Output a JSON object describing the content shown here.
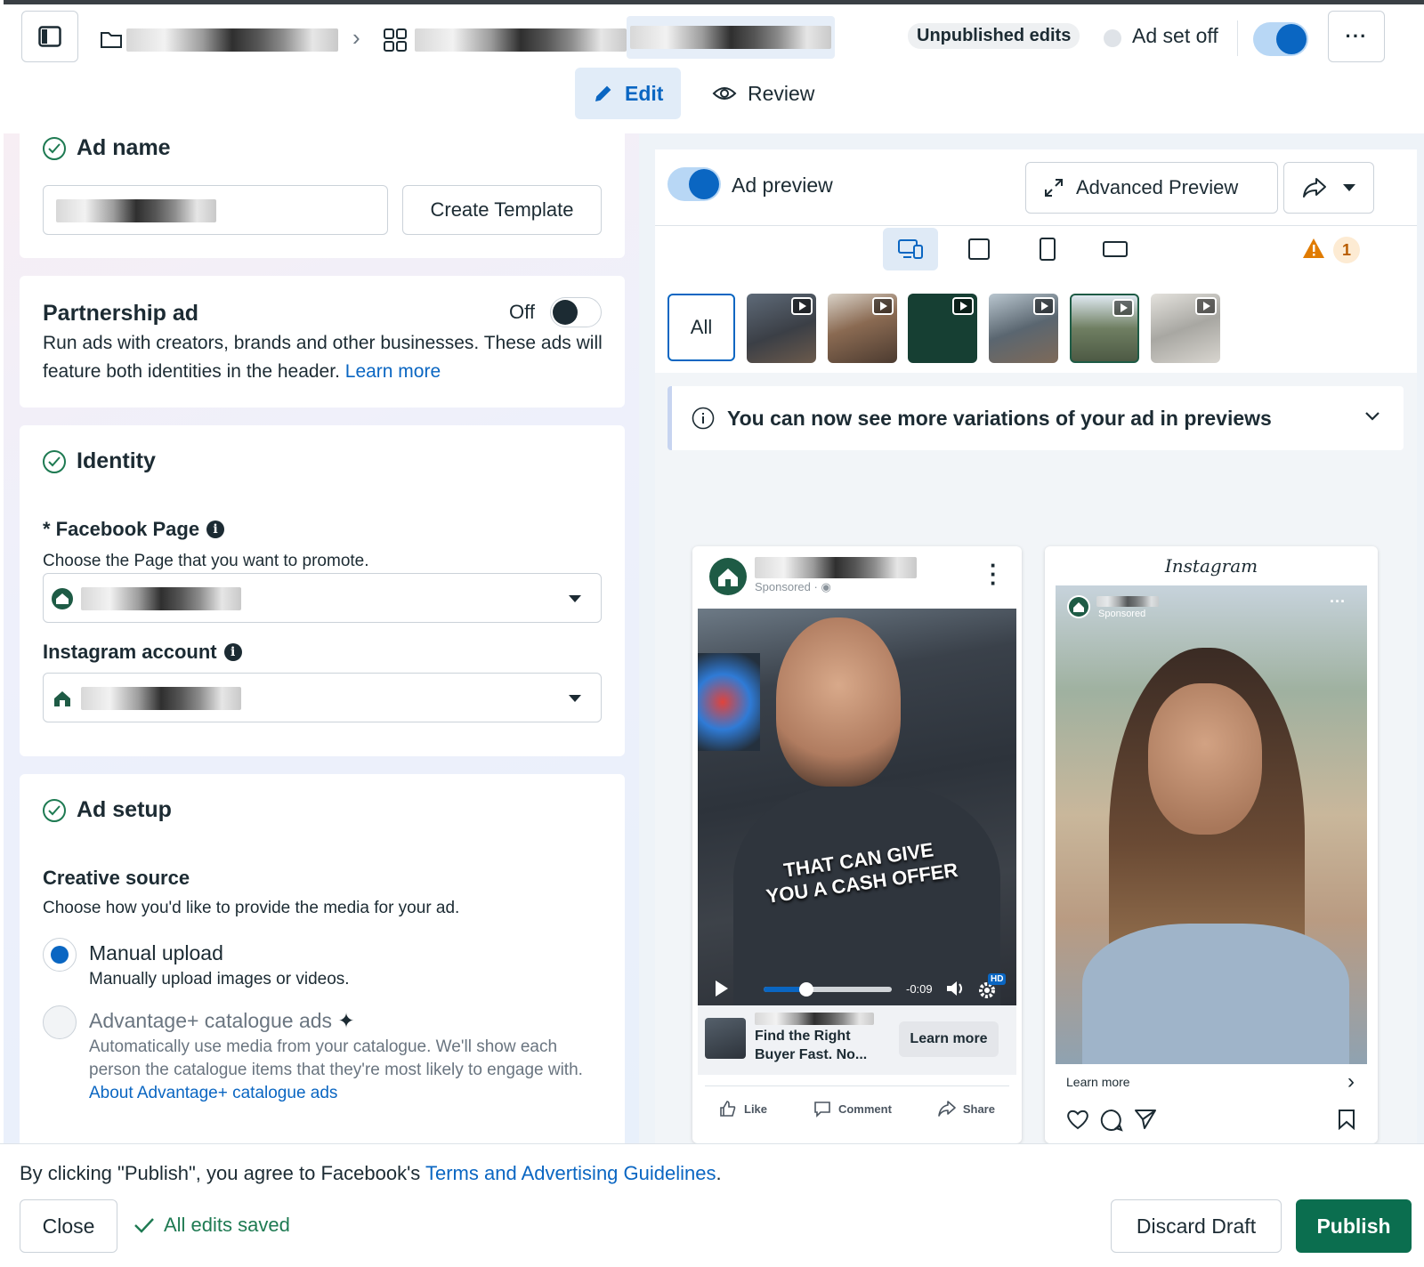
{
  "header": {
    "unpublished_label": "Unpublished edits",
    "adset_status": "Ad set off",
    "more_label": "···"
  },
  "tabs": {
    "edit": "Edit",
    "review": "Review"
  },
  "ad_name": {
    "title": "Ad name",
    "create_template": "Create Template"
  },
  "partnership": {
    "title": "Partnership ad",
    "toggle_state": "Off",
    "description": "Run ads with creators, brands and other businesses. These ads will feature both identities in the header.",
    "learn_more": "Learn more"
  },
  "identity": {
    "title": "Identity",
    "fb_page_label": "* Facebook Page",
    "fb_page_help": "Choose the Page that you want to promote.",
    "ig_label": "Instagram account"
  },
  "ad_setup": {
    "title": "Ad setup",
    "creative_source_title": "Creative source",
    "creative_source_help": "Choose how you'd like to provide the media for your ad.",
    "manual_title": "Manual upload",
    "manual_desc": "Manually upload images or videos.",
    "advantage_title": "Advantage+ catalogue ads",
    "advantage_desc": "Automatically use media from your catalogue. We'll show each person the catalogue items that they're most likely to engage with.",
    "advantage_link": "About Advantage+ catalogue ads"
  },
  "preview": {
    "toggle_label": "Ad preview",
    "advanced_preview": "Advanced Preview",
    "warning_count": "1",
    "all_label": "All",
    "notice": "You can now see more variations of your ad in previews",
    "fb": {
      "sponsored": "Sponsored · ",
      "caption_line1": "THAT CAN GIVE",
      "caption_line2": "YOU A CASH OFFER",
      "time": "-0:09",
      "hd": "HD",
      "headline_line1": "Find the Right",
      "headline_line2": "Buyer Fast. No...",
      "cta": "Learn more",
      "like": "Like",
      "comment": "Comment",
      "share": "Share"
    },
    "ig": {
      "logo": "Instagram",
      "sponsored": "Sponsored",
      "learn_more": "Learn more"
    }
  },
  "footer": {
    "agree_text": "By clicking \"Publish\", you agree to Facebook's ",
    "terms_link": "Terms and Advertising Guidelines",
    "period": ".",
    "close": "Close",
    "saved": "All edits saved",
    "discard": "Discard Draft",
    "publish": "Publish"
  },
  "colors": {
    "accent": "#0a66c2",
    "publish_green": "#0b6e4f",
    "check_green": "#1e7a52",
    "warning": "#e07b00"
  }
}
